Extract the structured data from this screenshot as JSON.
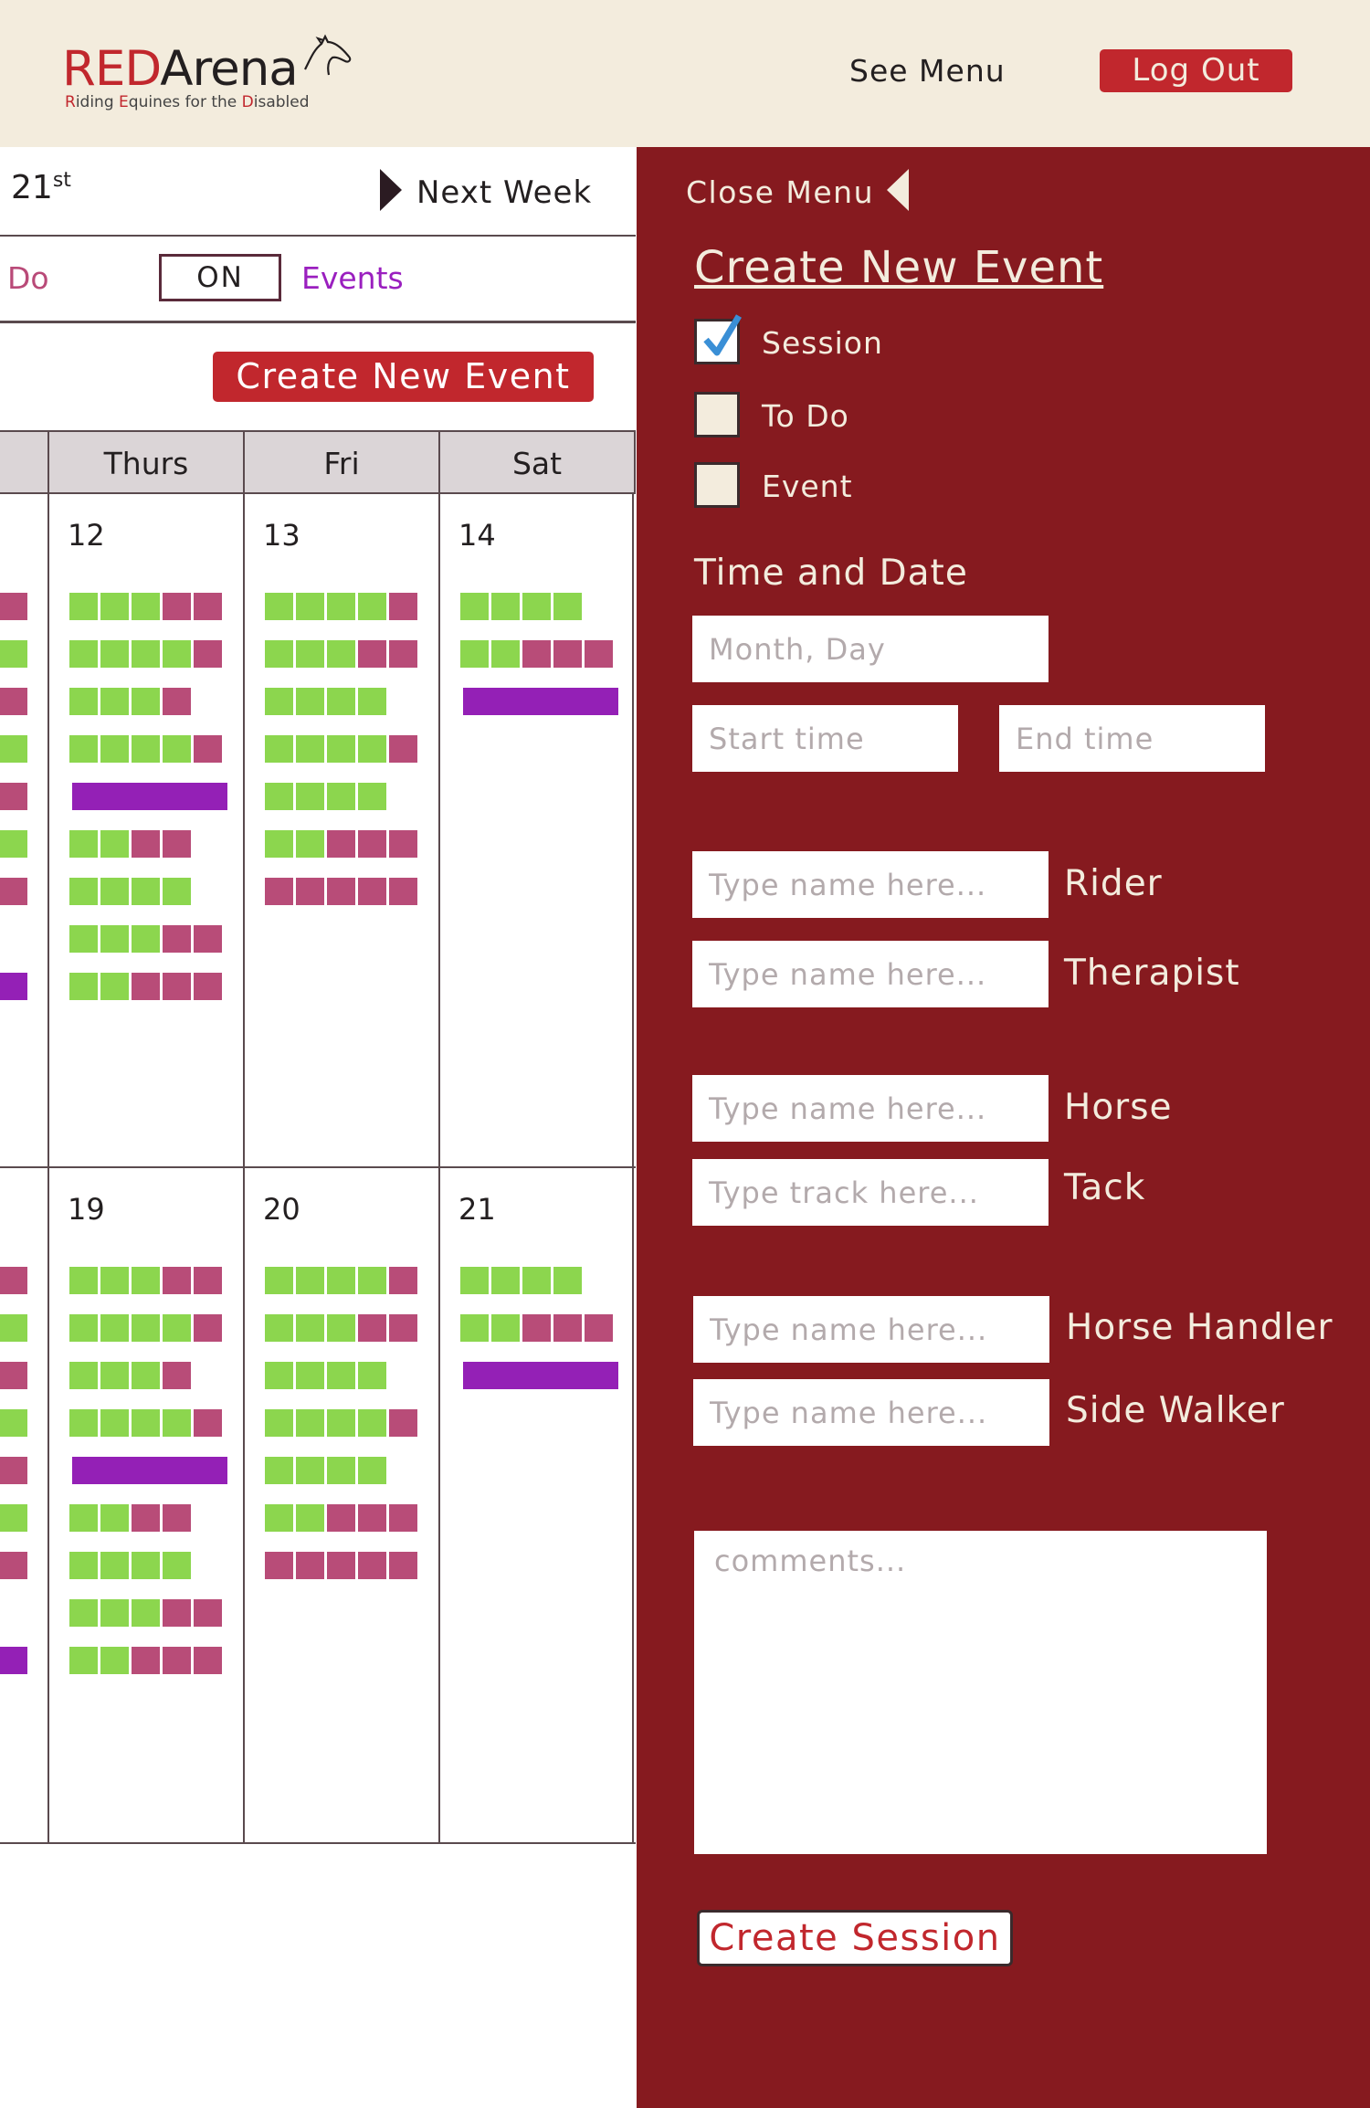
{
  "header": {
    "logo_red": "RED",
    "logo_black": "Arena",
    "logo_tagline": [
      "R",
      "iding ",
      "E",
      "quines for the ",
      "D",
      "isabled"
    ],
    "see_menu": "See Menu",
    "logout": "Log Out"
  },
  "week_nav": {
    "date": "21",
    "date_suffix": "st",
    "next_week": "Next Week"
  },
  "filters": {
    "todo": "Do",
    "toggle": "ON",
    "events": "Events"
  },
  "calendar": {
    "create_event": "Create New Event",
    "columns": [
      "Thurs",
      "Fri",
      "Sat"
    ],
    "weeks": [
      {
        "days": [
          {
            "num": "12",
            "rows": [
              "gggpp",
              "ggggp",
              "gggp",
              "ggggp",
              "bar",
              "ggpp",
              "gggg",
              "gggpp",
              "ggppp"
            ]
          },
          {
            "num": "13",
            "rows": [
              "ggggp",
              "gggpp",
              "gggg",
              "ggggp",
              "gggg",
              "ggppp",
              "ppppp"
            ]
          },
          {
            "num": "14",
            "rows": [
              "gggg",
              "ggppp",
              "bar"
            ]
          }
        ],
        "edge": [
          "p",
          "g",
          "p",
          "g",
          "p",
          "g",
          "p",
          "",
          "v"
        ]
      },
      {
        "days": [
          {
            "num": "19",
            "rows": [
              "gggpp",
              "ggggp",
              "gggp",
              "ggggp",
              "bar",
              "ggpp",
              "gggg",
              "gggpp",
              "ggppp"
            ]
          },
          {
            "num": "20",
            "rows": [
              "ggggp",
              "gggpp",
              "gggg",
              "ggggp",
              "gggg",
              "ggppp",
              "ppppp"
            ]
          },
          {
            "num": "21",
            "rows": [
              "gggg",
              "ggppp",
              "bar"
            ]
          }
        ],
        "edge": [
          "p",
          "g",
          "p",
          "g",
          "p",
          "g",
          "p",
          "",
          "v"
        ]
      }
    ]
  },
  "panel": {
    "close_menu": "Close Menu",
    "title": "Create New Event",
    "types": [
      {
        "label": "Session",
        "checked": true
      },
      {
        "label": "To Do",
        "checked": false
      },
      {
        "label": "Event",
        "checked": false
      }
    ],
    "time_date_label": "Time and Date",
    "month_day_placeholder": "Month, Day",
    "start_time_placeholder": "Start time",
    "end_time_placeholder": "End time",
    "people": [
      {
        "placeholder": "Type name here...",
        "label": "Rider"
      },
      {
        "placeholder": "Type name here...",
        "label": "Therapist"
      },
      {
        "placeholder": "Type name here...",
        "label": "Horse"
      },
      {
        "placeholder": "Type track here...",
        "label": "Tack"
      },
      {
        "placeholder": "Type name here...",
        "label": "Horse Handler"
      },
      {
        "placeholder": "Type name here...",
        "label": "Side Walker"
      }
    ],
    "comments_placeholder": "comments...",
    "create_session": "Create Session"
  },
  "colors": {
    "brand_red": "#c1272d",
    "panel_bg": "#861a1f",
    "header_bg": "#f3ecdd",
    "session_green": "#8cd64e",
    "session_pink": "#b84c78",
    "event_purple": "#9420b6"
  }
}
